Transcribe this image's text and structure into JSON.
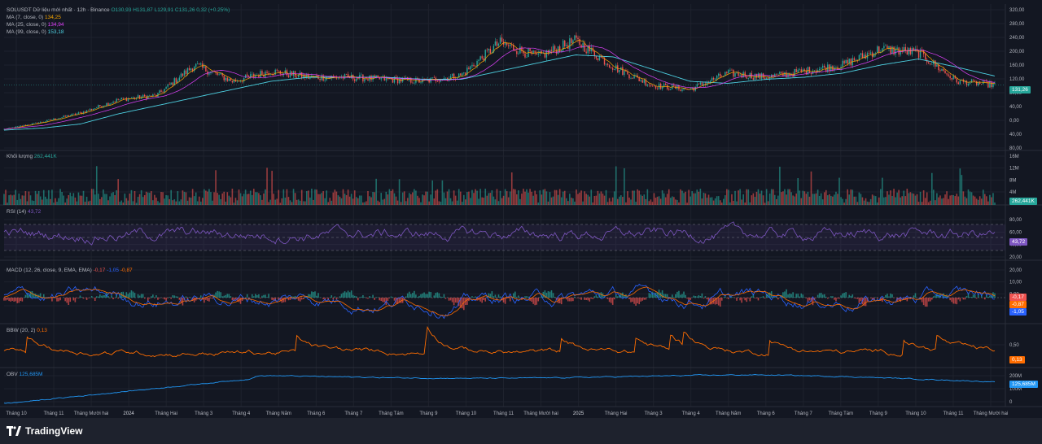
{
  "legend": {
    "symbol": "SOLUSDT Dữ liệu mới nhất · 12h · Binance",
    "open": "O130,93",
    "high": "H131,87",
    "low": "L129,91",
    "close": "C131,26",
    "change": "0,32 (+0.25%)",
    "ma7_label": "MA (7, close, 0)",
    "ma7_value": "134,25",
    "ma25_label": "MA (25, close, 0)",
    "ma25_value": "134,94",
    "ma99_label": "MA (99, close, 0)",
    "ma99_value": "153,18"
  },
  "volume": {
    "label": "Khối lượng",
    "value": "262,441K"
  },
  "rsi": {
    "label": "RSI (14)",
    "value": "43,72",
    "tag": "43,72"
  },
  "macd": {
    "label": "MACD (12, 26, close, 9, EMA, EMA)",
    "v1": "-0,17",
    "v2": "-1,05",
    "v3": "-0,87"
  },
  "bbw": {
    "label": "BBW (20, 2)",
    "value": "0,13",
    "tag": "0,13"
  },
  "obv": {
    "label": "OBV",
    "value": "125,685M",
    "tag": "125,685M"
  },
  "price_tag": "131,26",
  "volume_tag": "262,441K",
  "macd_tags": [
    "-0,17",
    "-0,87",
    "-1,05"
  ],
  "y_axis": {
    "price": [
      "320,00",
      "280,00",
      "240,00",
      "200,00",
      "160,00",
      "120,00",
      "80,00",
      "40,00",
      "0,00",
      "40,00",
      "80,00"
    ],
    "volume": [
      "16M",
      "12M",
      "8M",
      "4M"
    ],
    "rsi": [
      "80,00",
      "60,00",
      "40,00",
      "20,00"
    ],
    "macd": [
      "20,00",
      "10,00",
      "0,00",
      "-10,00"
    ],
    "bbw": [
      "0,50"
    ],
    "obv": [
      "200M",
      "100M",
      "0"
    ]
  },
  "x_axis": [
    "Tháng 10",
    "Tháng 11",
    "Tháng Mười hai",
    "2024",
    "Tháng Hai",
    "Tháng 3",
    "Tháng 4",
    "Tháng Năm",
    "Tháng 6",
    "Tháng 7",
    "Tháng Tám",
    "Tháng 9",
    "Tháng 10",
    "Tháng 11",
    "Tháng Mười hai",
    "2025",
    "Tháng Hai",
    "Tháng 3",
    "Tháng 4",
    "Tháng Năm",
    "Tháng 6",
    "Tháng 7",
    "Tháng Tám",
    "Tháng 9",
    "Tháng 10",
    "Tháng 11",
    "Tháng Mười hai"
  ],
  "brand": "TradingView",
  "colors": {
    "bg": "#131722",
    "up": "#26a69a",
    "down": "#ef5350",
    "ma7": "#f7a600",
    "ma25": "#e040fb",
    "ma99": "#4dd0e1",
    "rsi": "#7e57c2",
    "macd": "#2962ff",
    "signal": "#ff6d00",
    "bbw": "#ff6d00",
    "obv": "#2196f3"
  },
  "chart_data": {
    "type": "line",
    "title": "SOLUSDT",
    "x": [
      "2023-10",
      "2023-11",
      "2023-12",
      "2024-01",
      "2024-02",
      "2024-03",
      "2024-04",
      "2024-05",
      "2024-06",
      "2024-07",
      "2024-08",
      "2024-09",
      "2024-10",
      "2024-11",
      "2024-12",
      "2025-01",
      "2025-02",
      "2025-03",
      "2025-04",
      "2025-05",
      "2025-06",
      "2025-07",
      "2025-08",
      "2025-09",
      "2025-10",
      "2025-11",
      "2025-12"
    ],
    "series": [
      {
        "name": "close",
        "values": [
          22,
          40,
          62,
          95,
          105,
          180,
          140,
          165,
          150,
          150,
          145,
          140,
          155,
          235,
          200,
          240,
          175,
          130,
          120,
          160,
          150,
          165,
          180,
          220,
          210,
          140,
          131
        ]
      },
      {
        "name": "MA (99, close, 0)",
        "values": [
          20,
          25,
          35,
          60,
          80,
          100,
          120,
          140,
          150,
          150,
          150,
          145,
          145,
          165,
          185,
          205,
          200,
          170,
          140,
          135,
          145,
          150,
          160,
          180,
          195,
          175,
          153
        ]
      }
    ],
    "ylim": [
      0,
      320
    ]
  }
}
